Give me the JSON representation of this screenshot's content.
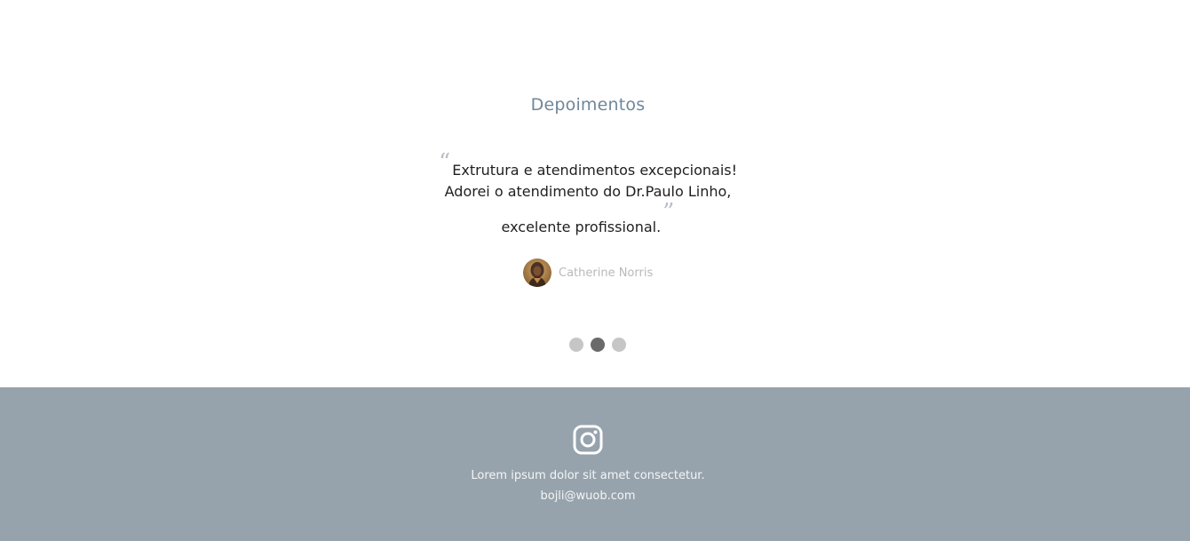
{
  "testimonials": {
    "title": "Depoimentos",
    "quote": {
      "open_mark": "“",
      "line1": "Extrutura e atendimentos excepcionais!",
      "line2": "Adorei o atendimento do Dr.Paulo Linho,",
      "line3": "excelente profissional.",
      "close_mark": "”"
    },
    "author": {
      "name": "Catherine Norris",
      "avatar_icon": "user-avatar-photo"
    },
    "carousel": {
      "slide_count": 3,
      "active_index": 1
    }
  },
  "footer": {
    "icon": "instagram-icon",
    "text": "Lorem ipsum dolor sit amet consectetur.",
    "email": "bojli@wuob.com"
  },
  "colors": {
    "title": "#6f879a",
    "quote_text": "#1f1f1f",
    "quote_marks": "#b7bec5",
    "author_name": "#b9b9b9",
    "dot_inactive": "#c6c6c6",
    "dot_active": "#6a6a6a",
    "footer_bg": "#97a3ac",
    "footer_text": "#f4f6f7"
  }
}
